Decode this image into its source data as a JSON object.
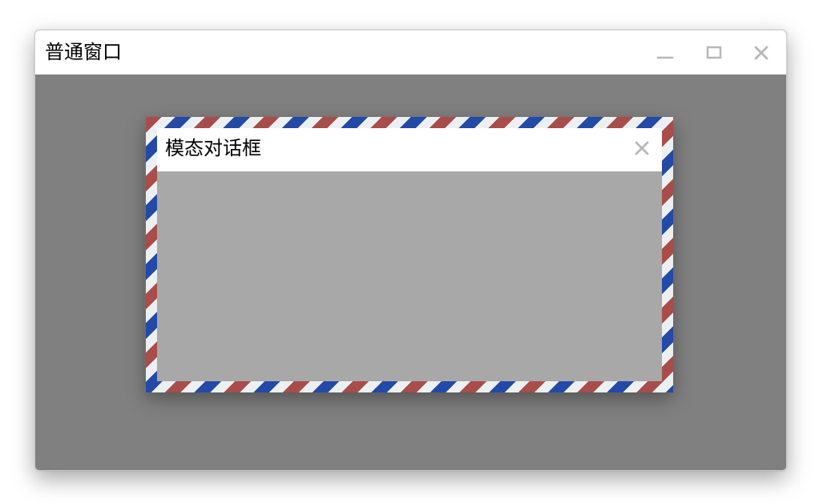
{
  "window": {
    "title": "普通窗口",
    "controls": {
      "minimize_icon": "minimize-icon",
      "maximize_icon": "maximize-icon",
      "close_icon": "close-icon"
    }
  },
  "modal": {
    "title": "模态对话框",
    "close_icon": "close-icon"
  },
  "colors": {
    "overlay": "#808080",
    "modal_body": "#a8a8a8",
    "airmail_red": "#a84d49",
    "airmail_blue": "#244aa8",
    "airmail_white": "#edf0f2",
    "control_icon": "#b8b8b8"
  }
}
